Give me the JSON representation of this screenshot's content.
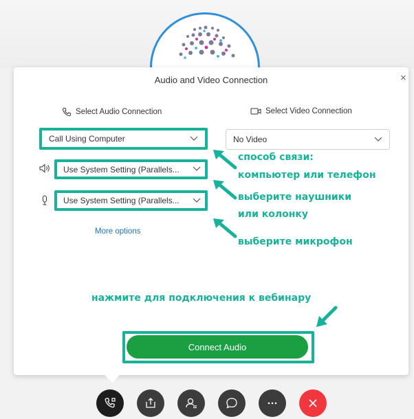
{
  "dialog": {
    "title": "Audio and Video Connection",
    "close_label": "×",
    "audio_section_label": "Select Audio Connection",
    "video_section_label": "Select Video Connection",
    "audio_connection_value": "Call Using Computer",
    "speaker_value": "Use System Setting (Parallels...",
    "microphone_value": "Use System Setting (Parallels...",
    "video_value": "No Video",
    "more_options": "More options",
    "connect_button": "Connect Audio"
  },
  "annotations": {
    "connection_line1": "способ связи:",
    "connection_line2": "компьютер или телефон",
    "speaker_line1": "выберите наушники",
    "speaker_line2": "или колонку",
    "microphone": "выберите микрофон",
    "connect": "нажмите для подключения к вебинару"
  },
  "toolbar": {
    "buttons": [
      {
        "icon": "audio-phone-icon",
        "color": "#1d1d1d"
      },
      {
        "icon": "share-icon",
        "color": "#3c3c3c"
      },
      {
        "icon": "participants-icon",
        "color": "#3c3c3c"
      },
      {
        "icon": "chat-icon",
        "color": "#3c3c3c"
      },
      {
        "icon": "more-icon",
        "color": "#3c3c3c"
      },
      {
        "icon": "leave-icon",
        "color": "#f0373e"
      }
    ]
  },
  "colors": {
    "highlight": "#18b29b",
    "connect_button": "#1aa043",
    "link": "#1e73be",
    "leave": "#f0373e"
  }
}
